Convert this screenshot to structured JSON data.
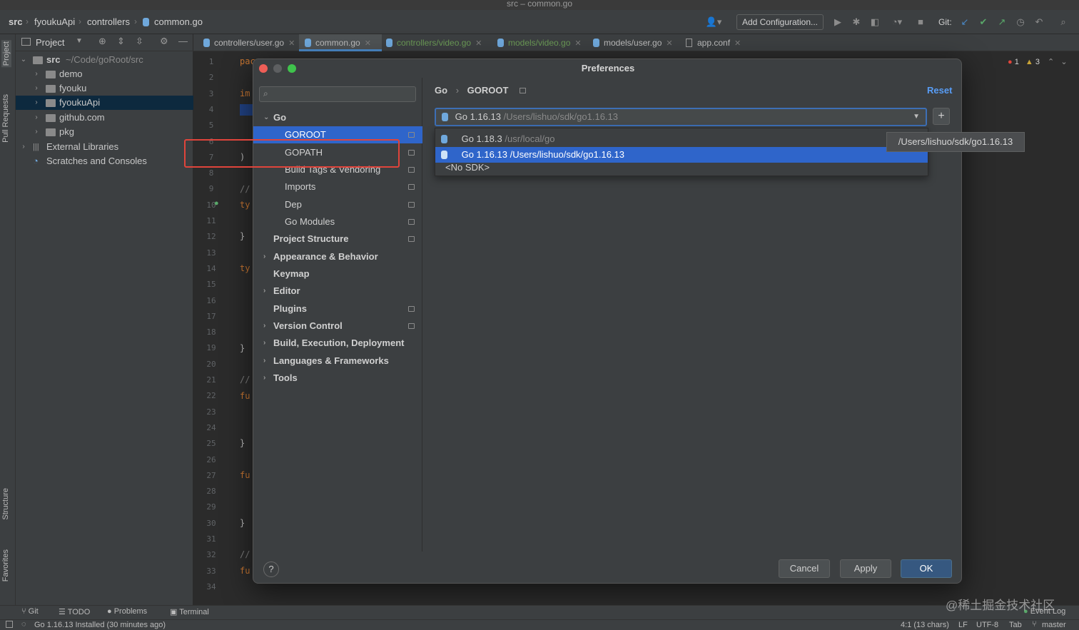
{
  "window": {
    "title": "src – common.go"
  },
  "breadcrumb": [
    "src",
    "fyoukuApi",
    "controllers",
    "common.go"
  ],
  "toolbar": {
    "add_configuration": "Add Configuration...",
    "git_label": "Git:"
  },
  "left_strip": {
    "project": "Project",
    "pull_requests": "Pull Requests",
    "structure": "Structure",
    "favorites": "Favorites"
  },
  "project_panel": {
    "title": "Project",
    "tree": [
      {
        "label": "src",
        "suffix": "~/Code/goRoot/src"
      },
      {
        "label": "demo"
      },
      {
        "label": "fyouku"
      },
      {
        "label": "fyoukuApi"
      },
      {
        "label": "github.com"
      },
      {
        "label": "pkg"
      },
      {
        "label": "External Libraries"
      },
      {
        "label": "Scratches and Consoles"
      }
    ]
  },
  "editor_tabs": [
    {
      "label": "controllers/user.go"
    },
    {
      "label": "common.go"
    },
    {
      "label": "controllers/video.go"
    },
    {
      "label": "models/video.go"
    },
    {
      "label": "models/user.go"
    },
    {
      "label": "app.conf"
    }
  ],
  "inspections": {
    "errors": "1",
    "warnings": "3"
  },
  "line_numbers": [
    "1",
    "2",
    "3",
    "4",
    "5",
    "6",
    "7",
    "8",
    "9",
    "10",
    "11",
    "12",
    "13",
    "14",
    "15",
    "16",
    "17",
    "18",
    "19",
    "20",
    "21",
    "22",
    "23",
    "24",
    "25",
    "26",
    "27",
    "28",
    "29",
    "30",
    "31",
    "32",
    "33",
    "34"
  ],
  "code_snippets": {
    "l1": "pac",
    "l3": "im",
    "l7": ")",
    "l9": "//",
    "l10": "ty",
    "l12": "}",
    "l14": "ty",
    "l19": "}",
    "l21": "//",
    "l22": "fu",
    "l25": "}",
    "l27": "fu",
    "l30": "}",
    "l32": "//",
    "l33": "fu"
  },
  "dialog": {
    "title": "Preferences",
    "search_placeholder": "",
    "nav": [
      {
        "label": "Go"
      },
      {
        "label": "GOROOT"
      },
      {
        "label": "GOPATH"
      },
      {
        "label": "Build Tags & Vendoring"
      },
      {
        "label": "Imports"
      },
      {
        "label": "Dep"
      },
      {
        "label": "Go Modules"
      },
      {
        "label": "Project Structure"
      },
      {
        "label": "Appearance & Behavior"
      },
      {
        "label": "Keymap"
      },
      {
        "label": "Editor"
      },
      {
        "label": "Plugins"
      },
      {
        "label": "Version Control"
      },
      {
        "label": "Build, Execution, Deployment"
      },
      {
        "label": "Languages & Frameworks"
      },
      {
        "label": "Tools"
      }
    ],
    "breadcrumb": {
      "parent": "Go",
      "current": "GOROOT"
    },
    "reset": "Reset",
    "sdk_selected": {
      "name": "Go 1.16.13",
      "path": "/Users/lishuo/sdk/go1.16.13"
    },
    "sdk_options": [
      {
        "name": "Go 1.18.3",
        "path": "/usr/local/go"
      },
      {
        "name": "Go 1.16.13",
        "path": "/Users/lishuo/sdk/go1.16.13"
      },
      {
        "name": "<No SDK>",
        "path": ""
      }
    ],
    "tooltip": "/Users/lishuo/sdk/go1.16.13",
    "buttons": {
      "help": "?",
      "cancel": "Cancel",
      "apply": "Apply",
      "ok": "OK"
    }
  },
  "bottom_tabs": [
    "Git",
    "TODO",
    "Problems",
    "Terminal"
  ],
  "event_log": "Event Log",
  "status": {
    "message": "Go 1.16.13 Installed (30 minutes ago)",
    "position": "4:1 (13 chars)",
    "line_sep": "LF",
    "encoding": "UTF-8",
    "indent": "Tab",
    "branch": "master"
  },
  "watermark": "@稀土掘金技术社区",
  "colors": {
    "accent": "#2f65ca",
    "link": "#589df6",
    "highlight_border": "#e0443b"
  }
}
